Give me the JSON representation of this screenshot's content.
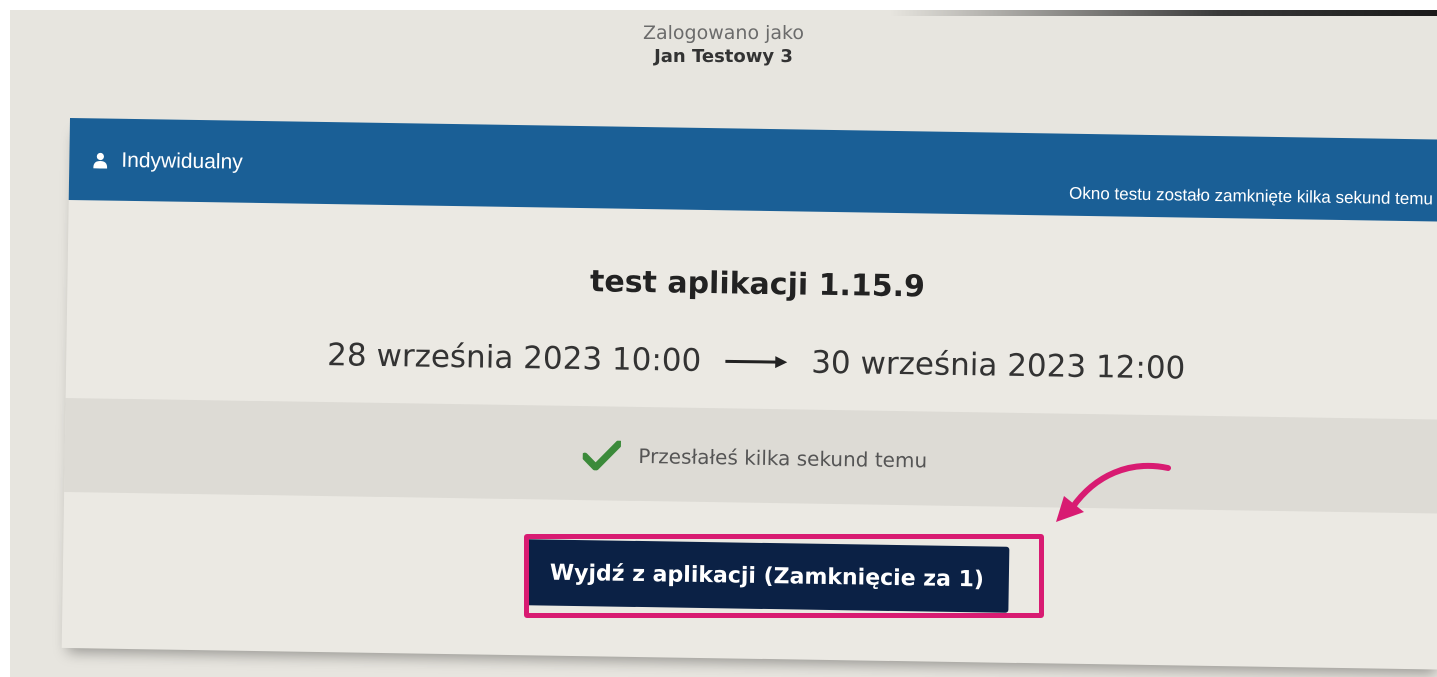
{
  "header": {
    "logged_in_label": "Zalogowano jako",
    "user_name": "Jan Testowy 3"
  },
  "card": {
    "mode_label": "Indywidualny",
    "mode_icon": "user-icon",
    "window_status": "Okno testu zostało zamknięte kilka sekund temu",
    "test_title": "test aplikacji 1.15.9",
    "start_date": "28 września 2023 10:00",
    "end_date": "30 września 2023 12:00",
    "submission_status": "Przesłałeś kilka sekund temu",
    "exit_button_label": "Wyjdź z aplikacji (Zamknięcie za 1)"
  },
  "colors": {
    "header_blue": "#1a5f96",
    "button_navy": "#0b2145",
    "check_green": "#3b8a3a",
    "annotation_pink": "#d81b72"
  }
}
